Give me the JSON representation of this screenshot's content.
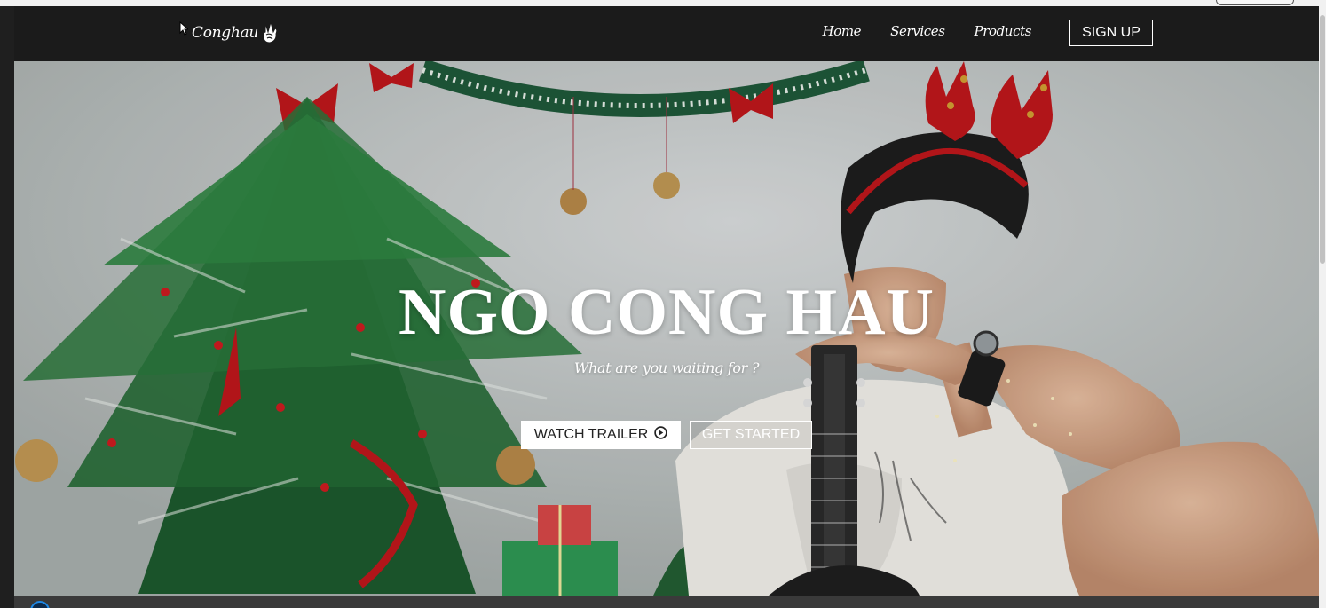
{
  "nav": {
    "logo_text": "Conghau",
    "links": [
      "Home",
      "Services",
      "Products"
    ],
    "signup_label": "SIGN UP"
  },
  "hero": {
    "title": "NGO CONG HAU",
    "subtitle": "What are you waiting for ?",
    "watch_label": "WATCH TRAILER",
    "started_label": "GET STARTED"
  },
  "colors": {
    "navbar_bg": "#1b1b1b",
    "text": "#ffffff",
    "accent": "#1e88e5"
  },
  "icons": {
    "logo_mark": "peace-hand-icon",
    "watch_button": "play-circle-icon",
    "cursor": "mouse-pointer-icon"
  }
}
